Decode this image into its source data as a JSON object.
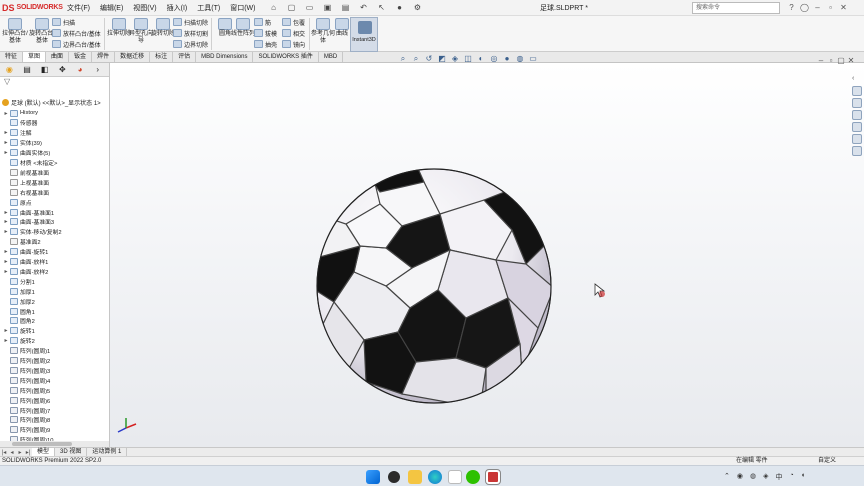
{
  "app": {
    "logo_mark": "DS",
    "logo_text": "SOLIDWORKS",
    "document_title": "足球.SLDPRT *",
    "search_placeholder": "搜索命令",
    "version": "SOLIDWORKS Premium 2022 SP2.0"
  },
  "menu": [
    "文件(F)",
    "编辑(E)",
    "视图(V)",
    "插入(I)",
    "工具(T)",
    "窗口(W)"
  ],
  "quick_access": [
    "home-icon",
    "new-icon",
    "open-icon",
    "save-icon",
    "print-icon",
    "undo-icon",
    "select-icon",
    "rebuild-icon",
    "options-icon"
  ],
  "ribbon": {
    "extrude_boss": "拉伸凸台/基体",
    "revolve_boss": "旋转凸台/基体",
    "sweep": "扫描",
    "loft": "放样凸台/基体",
    "boundary": "边界凸台/基体",
    "extrude_cut": "拉伸切除",
    "hole_wizard": "异型孔向导",
    "revolve_cut": "旋转切除",
    "sweep_cut": "扫描切除",
    "loft_cut": "放样切割",
    "boundary_cut": "边界切除",
    "fillet": "圆角",
    "linear_pattern": "线性阵列",
    "rib": "筋",
    "draft": "拔模",
    "shell": "抽壳",
    "wrap": "包覆",
    "intersect": "相交",
    "mirror": "镜向",
    "ref_geometry": "参考几何体",
    "curves": "曲线",
    "instant3d": "Instant3D"
  },
  "tabs": [
    {
      "label": "特征",
      "active": false
    },
    {
      "label": "草图",
      "active": true
    },
    {
      "label": "曲面",
      "active": false
    },
    {
      "label": "钣金",
      "active": false
    },
    {
      "label": "焊件",
      "active": false
    },
    {
      "label": "数据迁移",
      "active": false
    },
    {
      "label": "标注",
      "active": false
    },
    {
      "label": "评估",
      "active": false
    },
    {
      "label": "MBD Dimensions",
      "active": false
    },
    {
      "label": "SOLIDWORKS 插件",
      "active": false
    },
    {
      "label": "MBD",
      "active": false
    }
  ],
  "feature_manager": {
    "root": "足球 (默认) <<默认>_显示状态 1>",
    "items": [
      {
        "label": "History",
        "arrow": "▸"
      },
      {
        "label": "传感器",
        "arrow": ""
      },
      {
        "label": "注解",
        "arrow": "▸"
      },
      {
        "label": "实体(39)",
        "arrow": "▸"
      },
      {
        "label": "曲面实体(5)",
        "arrow": "▸"
      },
      {
        "label": "材质 <未指定>",
        "arrow": ""
      },
      {
        "label": "前视基准面",
        "arrow": ""
      },
      {
        "label": "上视基准面",
        "arrow": ""
      },
      {
        "label": "右视基准面",
        "arrow": ""
      },
      {
        "label": "原点",
        "arrow": ""
      },
      {
        "label": "曲面-基准面1",
        "arrow": "▸"
      },
      {
        "label": "曲面-基准面3",
        "arrow": "▸"
      },
      {
        "label": "实体-移动/复制2",
        "arrow": "▸"
      },
      {
        "label": "基准面2",
        "arrow": ""
      },
      {
        "label": "曲面-旋转1",
        "arrow": "▸"
      },
      {
        "label": "曲面-放样1",
        "arrow": "▸"
      },
      {
        "label": "曲面-放样2",
        "arrow": "▸"
      },
      {
        "label": "分割1",
        "arrow": ""
      },
      {
        "label": "加厚1",
        "arrow": ""
      },
      {
        "label": "加厚2",
        "arrow": ""
      },
      {
        "label": "圆角1",
        "arrow": ""
      },
      {
        "label": "圆角2",
        "arrow": ""
      },
      {
        "label": "旋转1",
        "arrow": "▸"
      },
      {
        "label": "旋转2",
        "arrow": "▸"
      },
      {
        "label": "阵列(圆周)1",
        "arrow": ""
      },
      {
        "label": "阵列(圆周)2",
        "arrow": ""
      },
      {
        "label": "阵列(圆周)3",
        "arrow": ""
      },
      {
        "label": "阵列(圆周)4",
        "arrow": ""
      },
      {
        "label": "阵列(圆周)5",
        "arrow": ""
      },
      {
        "label": "阵列(圆周)6",
        "arrow": ""
      },
      {
        "label": "阵列(圆周)7",
        "arrow": ""
      },
      {
        "label": "阵列(圆周)8",
        "arrow": ""
      },
      {
        "label": "阵列(圆周)9",
        "arrow": ""
      },
      {
        "label": "阵列(圆周)10",
        "arrow": ""
      }
    ]
  },
  "model_tabs": [
    {
      "label": "模型",
      "active": true
    },
    {
      "label": "3D 视图",
      "active": false
    },
    {
      "label": "运动算例 1",
      "active": false
    }
  ],
  "status": {
    "mode": "在编辑 零件",
    "units": "自定义"
  },
  "taskbar": {
    "ime": "中",
    "time": "",
    "date": ""
  },
  "colors": {
    "brand": "#d62a2a",
    "active_tab": "#ffffff",
    "ball_dark": "#111111",
    "ball_light": "#f4f4f6"
  }
}
